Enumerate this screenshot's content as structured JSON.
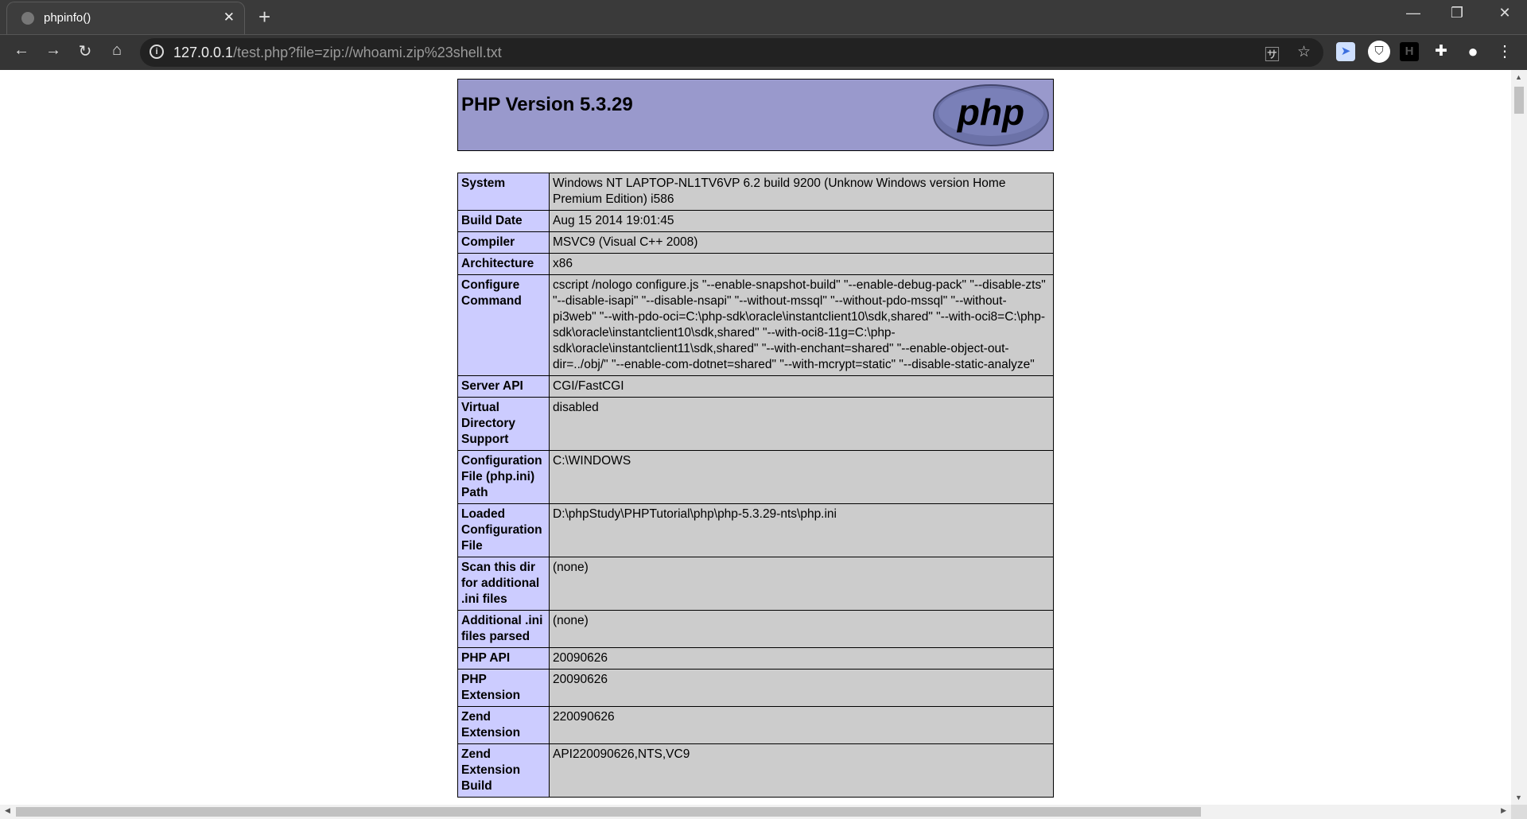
{
  "browser": {
    "tab_title": "phpinfo()",
    "url_host": "127.0.0.1",
    "url_path": "/test.php?file=zip://whoami.zip%23shell.txt",
    "extensions": [
      "translate-icon",
      "bookmark-star-icon",
      "bird-extension-icon",
      "shield-extension-icon",
      "h-extension-icon",
      "puzzle-extensions-icon",
      "profile-icon",
      "menu-icon"
    ]
  },
  "page": {
    "title": "PHP Version 5.3.29",
    "logo_text": "php",
    "colors": {
      "header": "#9999cc",
      "label": "#ccccff",
      "value": "#cccccc"
    },
    "rows": [
      {
        "label": "System",
        "value": "Windows NT LAPTOP-NL1TV6VP 6.2 build 9200 (Unknow Windows version Home Premium Edition) i586"
      },
      {
        "label": "Build Date",
        "value": "Aug 15 2014 19:01:45"
      },
      {
        "label": "Compiler",
        "value": "MSVC9 (Visual C++ 2008)"
      },
      {
        "label": "Architecture",
        "value": "x86"
      },
      {
        "label": "Configure Command",
        "value": "cscript /nologo configure.js \"--enable-snapshot-build\" \"--enable-debug-pack\" \"--disable-zts\" \"--disable-isapi\" \"--disable-nsapi\" \"--without-mssql\" \"--without-pdo-mssql\" \"--without-pi3web\" \"--with-pdo-oci=C:\\php-sdk\\oracle\\instantclient10\\sdk,shared\" \"--with-oci8=C:\\php-sdk\\oracle\\instantclient10\\sdk,shared\" \"--with-oci8-11g=C:\\php-sdk\\oracle\\instantclient11\\sdk,shared\" \"--with-enchant=shared\" \"--enable-object-out-dir=../obj/\" \"--enable-com-dotnet=shared\" \"--with-mcrypt=static\" \"--disable-static-analyze\""
      },
      {
        "label": "Server API",
        "value": "CGI/FastCGI"
      },
      {
        "label": "Virtual Directory Support",
        "value": "disabled"
      },
      {
        "label": "Configuration File (php.ini) Path",
        "value": "C:\\WINDOWS"
      },
      {
        "label": "Loaded Configuration File",
        "value": "D:\\phpStudy\\PHPTutorial\\php\\php-5.3.29-nts\\php.ini"
      },
      {
        "label": "Scan this dir for additional .ini files",
        "value": "(none)"
      },
      {
        "label": "Additional .ini files parsed",
        "value": "(none)"
      },
      {
        "label": "PHP API",
        "value": "20090626"
      },
      {
        "label": "PHP Extension",
        "value": "20090626"
      },
      {
        "label": "Zend Extension",
        "value": "220090626"
      },
      {
        "label": "Zend Extension Build",
        "value": "API220090626,NTS,VC9"
      }
    ]
  }
}
